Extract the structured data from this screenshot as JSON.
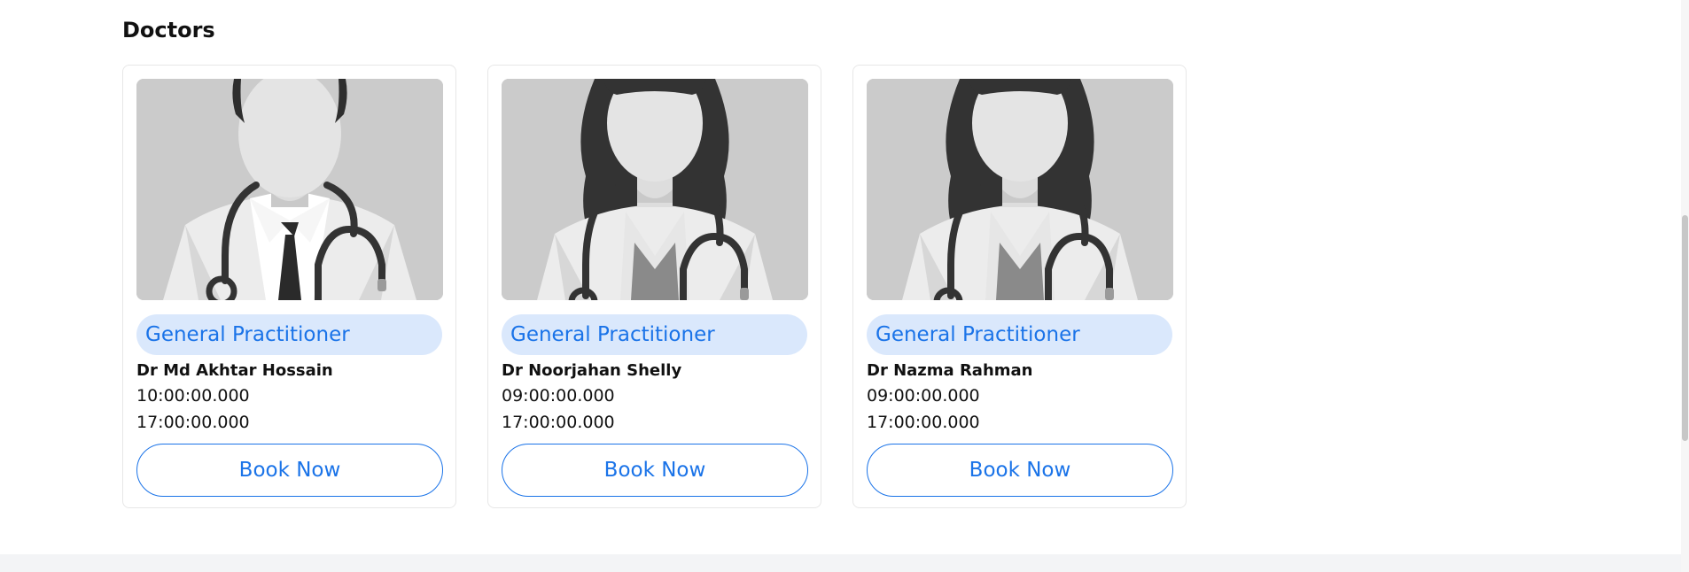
{
  "section": {
    "title": "Doctors"
  },
  "doctors": [
    {
      "specialty": "General Practitioner",
      "name": "Dr Md Akhtar Hossain",
      "start_time": "10:00:00.000",
      "end_time": "17:00:00.000",
      "button_label": "Book Now",
      "avatar": "male-doctor-illustration"
    },
    {
      "specialty": "General Practitioner",
      "name": "Dr Noorjahan Shelly",
      "start_time": "09:00:00.000",
      "end_time": "17:00:00.000",
      "button_label": "Book Now",
      "avatar": "female-doctor-illustration"
    },
    {
      "specialty": "General Practitioner",
      "name": "Dr Nazma Rahman",
      "start_time": "09:00:00.000",
      "end_time": "17:00:00.000",
      "button_label": "Book Now",
      "avatar": "female-doctor-illustration"
    }
  ],
  "colors": {
    "accent": "#1a73e8",
    "badge_bg": "#dae8fc",
    "photo_bg": "#cbcbcb",
    "footer_bg": "#f3f4f6"
  }
}
